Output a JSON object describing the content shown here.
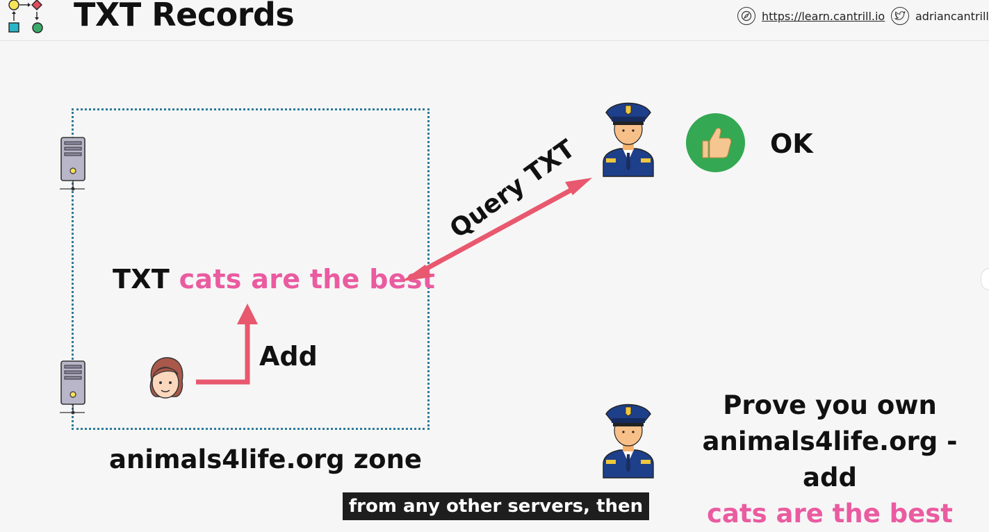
{
  "header": {
    "title": "TXT Records",
    "website": "https://learn.cantrill.io",
    "twitter": "adriancantrill"
  },
  "diagram": {
    "txt_prefix": "TXT",
    "txt_value": "cats are the best",
    "add_label": "Add",
    "zone_label": "animals4life.org zone",
    "query_label": "Query TXT",
    "ok_label": "OK",
    "prove_line1": "Prove you own",
    "prove_line2": "animals4life.org - add",
    "prove_line3": "cats are the best"
  },
  "colors": {
    "accent_pink": "#ea5ba0",
    "arrow_red": "#e8586e",
    "zone_border": "#2c7a9a",
    "ok_green": "#34a853"
  },
  "caption": "from any other servers, then"
}
